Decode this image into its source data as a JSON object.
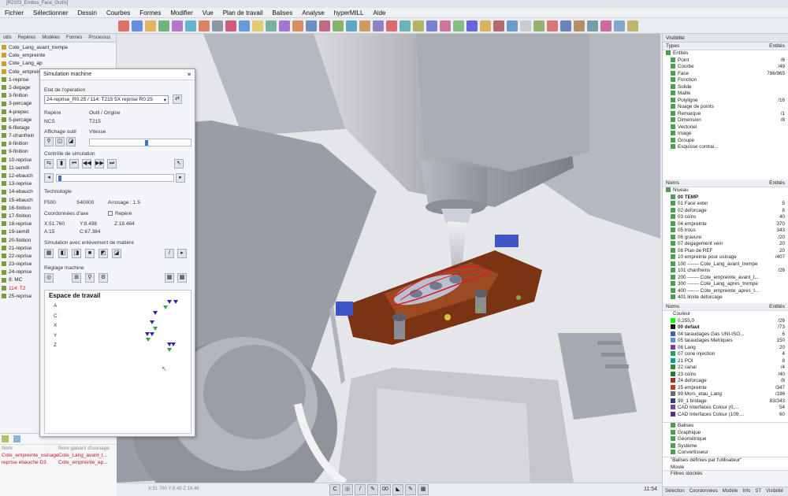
{
  "titlebar": {
    "text": "[R2103_Embos_Face_Outils]"
  },
  "menu": [
    "Fichier",
    "Sélectionner",
    "Dessin",
    "Courbes",
    "Formes",
    "Modifier",
    "Vue",
    "Plan de travail",
    "Balises",
    "Analyse",
    "hyperMILL",
    "Aide"
  ],
  "left_panel": {
    "tabs": [
      "utils",
      "Repères",
      "Modèles",
      "Formes",
      "Processus"
    ],
    "items": [
      "Cote_Lang_avant_trempe",
      "Cote_empreinte",
      "Cote_Lang_ap",
      "Cote_empreinte",
      "1-reprise",
      "2-degage",
      "3-finition",
      "3-percage",
      "4-prepec",
      "5-percage",
      "6-filetage",
      "7-chanfrein",
      "8-finition",
      "9-finition",
      "10-reprise",
      "11-semifi",
      "12-ebauch",
      "13-reprise",
      "14-ebauch",
      "15-ebauch",
      "16-finition",
      "17-finition",
      "18-reprise",
      "19-semifi",
      "20-finition",
      "21-reprise",
      "22-reprise",
      "23-reprise",
      "24-reprise",
      "8: MC",
      "114: T2",
      "25-reprise"
    ],
    "bottom_header": [
      "Nom",
      "Nom gabarit d'usinage"
    ],
    "bottom_rows": [
      [
        "Nom",
        "Nom gabarit d'usinage"
      ],
      [
        "Cote_empreinte_usinage",
        "Cote_Lang_avant_t..."
      ],
      [
        "reprise ebauche D3",
        "Cote_empreinte_ap..."
      ]
    ]
  },
  "dialog": {
    "title": "Simulation machine",
    "etat_label": "Etat de l'opération",
    "operation_value": "24-reprise_R0.25 / 114: T215 5X reprise R0.25",
    "repere_label": "Repère",
    "outil_label": "Outil / Origine",
    "ncs": "NCS",
    "outil_value": "T215",
    "affichage_label": "Affichage outil",
    "vitesse_label": "Vitesse",
    "controle_label": "Contrôle de simulation",
    "technologie_label": "Technologie",
    "f_value": "F500",
    "s_value": "S40000",
    "arrosage": "Arrosage : 1.5",
    "coord_label": "Coordonnées d'axe",
    "repere_check": "Repère",
    "x": "X:51.760",
    "y": "Y:8.498",
    "z": "Z:18.464",
    "a": "A:15",
    "c": "C:67.384",
    "enlevement_label": "Simulation avec enlèvement de matière",
    "reglage_label": "Réglage machine",
    "workspace_title": "Espace de travail",
    "axes": [
      "A",
      "C",
      "X",
      "Y",
      "Z"
    ]
  },
  "right_panel": {
    "visibility_title": "Visibilité",
    "cols1": [
      "Types",
      "Entités"
    ],
    "entities": [
      [
        "Entités",
        ""
      ],
      [
        "Point",
        "/6"
      ],
      [
        "Courbe",
        "/49"
      ],
      [
        "Face",
        "786/965"
      ],
      [
        "Fonction",
        ""
      ],
      [
        "Solide",
        ""
      ],
      [
        "Maille",
        ""
      ],
      [
        "Polyligne",
        "/16"
      ],
      [
        "Nuage de points",
        ""
      ],
      [
        "Remarque",
        "/1"
      ],
      [
        "Dimension",
        "/8"
      ],
      [
        "Vectoriel",
        ""
      ],
      [
        "Image",
        ""
      ],
      [
        "Groupe",
        ""
      ],
      [
        "Esquisse contrai...",
        ""
      ]
    ],
    "cols2": [
      "Noms",
      "Entités"
    ],
    "niveaux": [
      [
        "Niveau",
        ""
      ],
      [
        "00 TEMP",
        ""
      ],
      [
        "01 Face exter",
        "5"
      ],
      [
        "02 deforcage",
        "8"
      ],
      [
        "03 coins",
        "40"
      ],
      [
        "04 empreinte",
        "370"
      ],
      [
        "05 trous",
        "343"
      ],
      [
        "06 gravure",
        "/20"
      ],
      [
        "07 degagement vein",
        "20"
      ],
      [
        "08 Plan de REF",
        "20"
      ],
      [
        "10 empreinte pour usinage",
        "/407"
      ],
      [
        "100 ------- Cote_Lang_avant_trempe",
        ""
      ],
      [
        "101 chanfreins",
        "/26"
      ],
      [
        "200 ------- Cote_empreinte_avant_t...",
        ""
      ],
      [
        "300 ------- Cote_Lang_apres_trempe",
        ""
      ],
      [
        "400 ------- Cote_empreinte_apres_t...",
        ""
      ],
      [
        "401 limite deforcage",
        ""
      ]
    ],
    "cols3": [
      "Noms",
      "Entités"
    ],
    "couleurs": [
      [
        "Couleur",
        "",
        "#ffffff"
      ],
      [
        "0,255,0",
        "/26",
        "#00ff00"
      ],
      [
        "00 defaut",
        "/73",
        "#1a1a1a"
      ],
      [
        "04 taraudages Gas UNI-ISO...",
        "6",
        "#3a5fc0"
      ],
      [
        "05 taraudages Metriques",
        "150",
        "#5a8fd6"
      ],
      [
        "06 Lang",
        "20",
        "#7b3fa0"
      ],
      [
        "07 cone injection",
        "4",
        "#2b9e5a"
      ],
      [
        "21 POI",
        "8",
        "#00a0a0"
      ],
      [
        "22 canal",
        "/4",
        "#2a8f2a"
      ],
      [
        "23 coins",
        "/40",
        "#1f7a38"
      ],
      [
        "24 deforcage",
        "/8",
        "#a03030"
      ],
      [
        "25 empreinte",
        "/347",
        "#c03a1a"
      ],
      [
        "99 Mors_etau_Lang",
        "/196",
        "#6a6a6a"
      ],
      [
        "99_1 bridage",
        "83/343",
        "#304080"
      ],
      [
        "CAD Interfaces Colour (0,...",
        "54",
        "#8040a0"
      ],
      [
        "CAD Interfaces Colour (109,...",
        "60",
        "#50308a"
      ]
    ],
    "balises": [
      "Balises",
      "Graphique",
      "Géométrique",
      "Système",
      "Convertisseur"
    ],
    "user_tags": [
      "\"Balises définies par l'utilisateur\"",
      "Moule"
    ],
    "filters": "Filtres stockés",
    "tabs": [
      "Sélection",
      "Coordonnées",
      "Modèle",
      "Info",
      "ST",
      "Visibilité"
    ]
  },
  "bottom": {
    "icons": [
      "C",
      "◎",
      "/",
      "✎",
      "00",
      "◣",
      "✎",
      "▦"
    ],
    "status": "X:51.760 Y:8.49 Z:18.46",
    "clock": "11:54"
  },
  "colors": {
    "tool_red": "#e0182a",
    "part_brown": "#7a3414",
    "accent_blue": "#3d74c9"
  }
}
